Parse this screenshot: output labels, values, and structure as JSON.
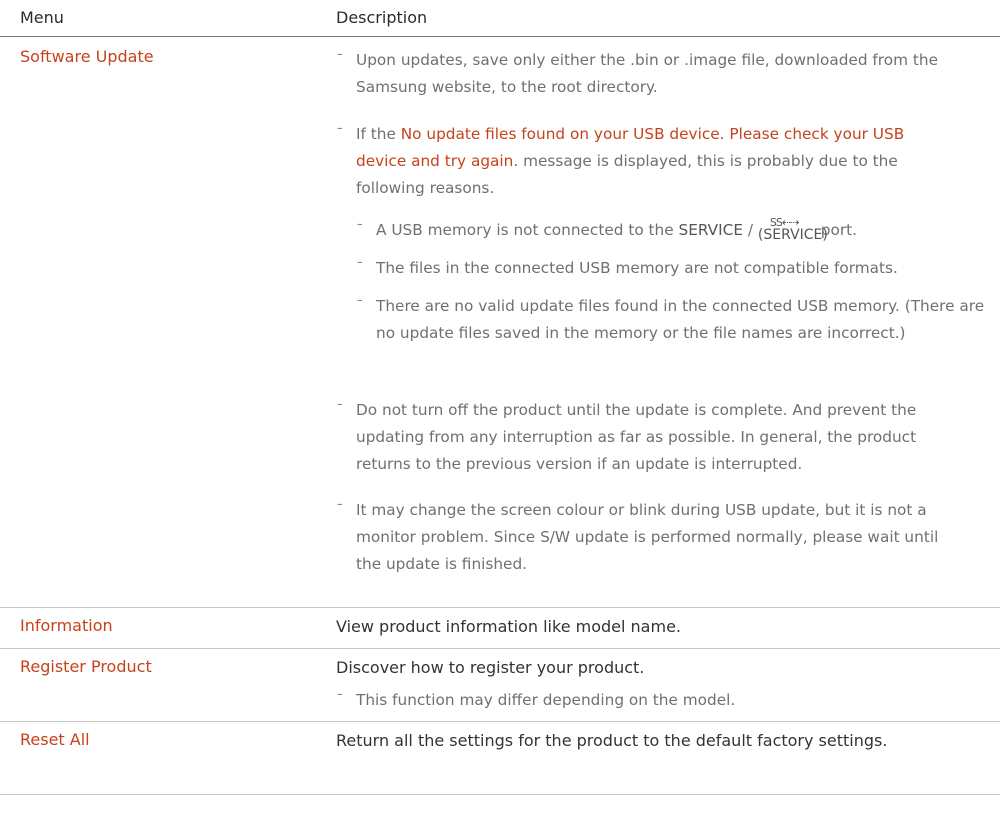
{
  "header": {
    "menu": "Menu",
    "description": "Description"
  },
  "software_update": {
    "name": "Software Update",
    "notes": {
      "n1": "Upon updates, save only either the .bin or .image file, downloaded from the Samsung website, to the root directory.",
      "n2_pre": "If the ",
      "n2_hl": "No update files found on your USB device. Please check your USB device and try again.",
      "n2_post": " message is displayed, this is probably due to the following reasons.",
      "sub1_pre": "A USB memory is not connected to the ",
      "sub1_service": "SERVICE",
      "sub1_slash": " / ",
      "sub1_icon_label": "(SERVICE)",
      "sub1_post": " port.",
      "sub2": "The files in the connected USB memory are not compatible formats.",
      "sub3": "There are no valid update files found in the connected USB memory. (There are no update files saved in the memory or the file names are incorrect.)",
      "n3": "Do not turn off the product until the update is complete. And prevent the updating from any interruption as far as possible. In general, the product returns to the previous version if an update is interrupted.",
      "n4": "It may change the screen colour or blink during USB update, but it is not a monitor problem. Since S/W update is performed normally, please wait until the update is finished."
    }
  },
  "information": {
    "name": "Information",
    "desc": "View product information like model name."
  },
  "register_product": {
    "name": "Register Product",
    "desc": "Discover how to register your product.",
    "note": "This function may differ depending on the model."
  },
  "reset_all": {
    "name": "Reset All",
    "desc": "Return all the settings for the product to the default factory settings."
  },
  "dash_glyph": "¯",
  "icons": {
    "usb": "usb-superspeed-icon"
  },
  "colors": {
    "accent": "#c7421a",
    "text": "#333333",
    "note": "#707070"
  }
}
